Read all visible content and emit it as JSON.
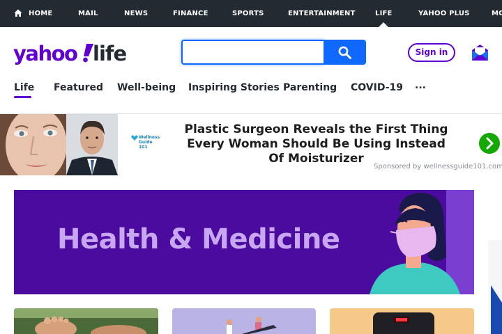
{
  "topnav": {
    "items": [
      {
        "label": "HOME",
        "icon": "home-icon"
      },
      {
        "label": "MAIL"
      },
      {
        "label": "NEWS"
      },
      {
        "label": "FINANCE"
      },
      {
        "label": "SPORTS"
      },
      {
        "label": "ENTERTAINMENT"
      },
      {
        "label": "LIFE",
        "active": true
      },
      {
        "label": "YAHOO PLUS"
      },
      {
        "label": "MO"
      }
    ],
    "bg": "#232a31"
  },
  "header": {
    "logo_text": "yahoo!life",
    "search": {
      "placeholder": "",
      "value": ""
    },
    "signin_label": "Sign in",
    "mail_icon": "mail-icon",
    "brand_color": "#6001d2",
    "search_color": "#0f69ff"
  },
  "subnav": {
    "items": [
      "Life",
      "Featured",
      "Well-being",
      "Inspiring Stories",
      "Parenting",
      "COVID-19",
      "..."
    ],
    "active": "Life"
  },
  "ad": {
    "brand": "Wellness Guide 101",
    "headline_line1": "Plastic Surgeon Reveals the First Thing",
    "headline_line2": "Every Woman Should Be Using Instead",
    "headline_line3": "Of Moisturizer",
    "sponsor": "Sponsored by wellnessguide101.com",
    "arrow_icon": "chevron-right-icon"
  },
  "banner": {
    "title": "Health & Medicine",
    "bg": "#4a0b9e",
    "title_color": "#c7a6f2"
  }
}
